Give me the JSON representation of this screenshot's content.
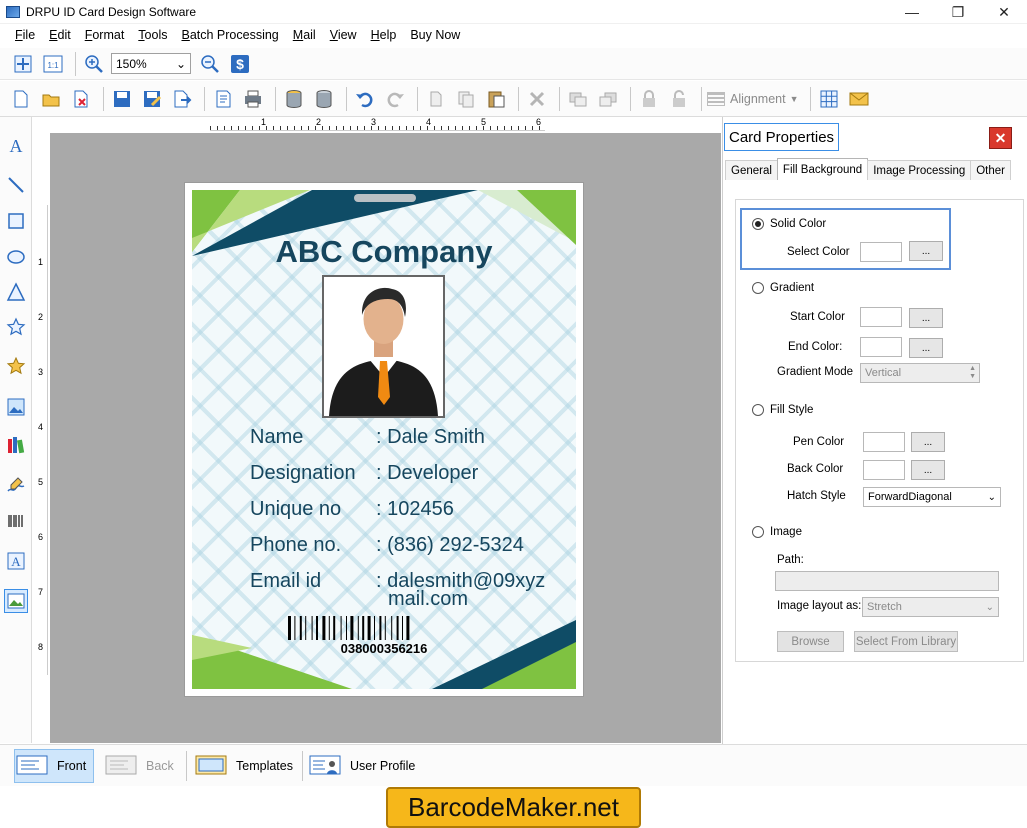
{
  "window": {
    "title": "DRPU ID Card Design Software"
  },
  "menu": {
    "items": [
      {
        "label": "File",
        "u": "F",
        "rest": "ile"
      },
      {
        "label": "Edit",
        "u": "E",
        "rest": "dit"
      },
      {
        "label": "Format",
        "u": "F",
        "rest": "ormat"
      },
      {
        "label": "Tools",
        "u": "T",
        "rest": "ools"
      },
      {
        "label": "Batch Processing",
        "u": "B",
        "rest": "atch Processing"
      },
      {
        "label": "Mail",
        "u": "M",
        "rest": "ail"
      },
      {
        "label": "View",
        "u": "V",
        "rest": "iew"
      },
      {
        "label": "Help",
        "u": "H",
        "rest": "elp"
      },
      {
        "label": "Buy Now",
        "u": "",
        "rest": "Buy Now"
      }
    ]
  },
  "toolbar": {
    "zoom_value": "150%",
    "alignment_label": "Alignment",
    "actual_size_label": "1:1"
  },
  "ruler": {
    "h_marks": [
      "1",
      "2",
      "3",
      "4",
      "5",
      "6"
    ],
    "v_marks": [
      "1",
      "2",
      "3",
      "4",
      "5",
      "6",
      "7",
      "8"
    ]
  },
  "card": {
    "company": "ABC Company",
    "fields": [
      {
        "label": "Name",
        "value": ": Dale Smith"
      },
      {
        "label": "Designation",
        "value": ": Developer"
      },
      {
        "label": "Unique no",
        "value": ": 102456"
      },
      {
        "label": "Phone no.",
        "value": ": (836) 292-5324"
      },
      {
        "label": "Email id",
        "value": ": dalesmith@09xyz",
        "value2": "mail.com"
      }
    ],
    "barcode_number": "038000356216",
    "colors": {
      "title": "#16465e",
      "accent_green": "#7fc241",
      "accent_dark": "#0f4c66"
    }
  },
  "panel": {
    "title": "Card Properties",
    "tabs": [
      "General",
      "Fill Background",
      "Image Processing",
      "Other"
    ],
    "active_tab": "Fill Background",
    "solid_color": {
      "label": "Solid Color",
      "select_color_label": "Select Color",
      "button": "..."
    },
    "gradient": {
      "label": "Gradient",
      "start_color_label": "Start Color",
      "end_color_label": "End Color:",
      "mode_label": "Gradient Mode",
      "mode_value": "Vertical",
      "button": "..."
    },
    "fill_style": {
      "label": "Fill Style",
      "pen_color_label": "Pen Color",
      "back_color_label": "Back Color",
      "hatch_style_label": "Hatch Style",
      "hatch_style_value": "ForwardDiagonal",
      "button": "..."
    },
    "image": {
      "label": "Image",
      "path_label": "Path:",
      "path_value": "",
      "layout_label": "Image layout as:",
      "layout_value": "Stretch",
      "browse_label": "Browse",
      "library_label": "Select From Library"
    }
  },
  "bottom": {
    "front": "Front",
    "back": "Back",
    "templates": "Templates",
    "user_profile": "User Profile"
  },
  "watermark": "BarcodeMaker.net"
}
